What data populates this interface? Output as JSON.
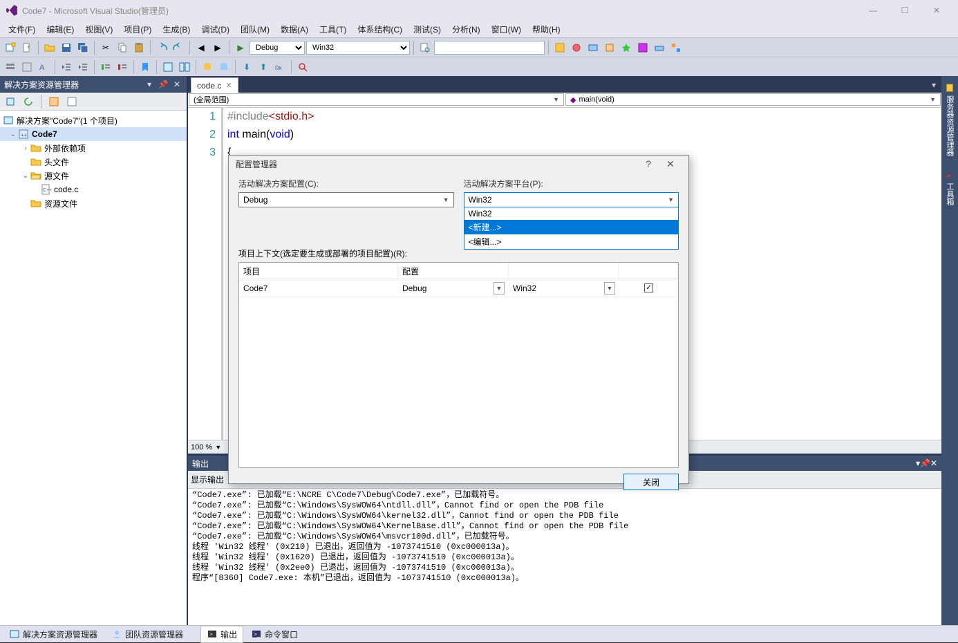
{
  "window": {
    "title": "Code7 - Microsoft Visual Studio(管理员)"
  },
  "menu": [
    "文件(F)",
    "编辑(E)",
    "视图(V)",
    "项目(P)",
    "生成(B)",
    "调试(D)",
    "团队(M)",
    "数据(A)",
    "工具(T)",
    "体系结构(C)",
    "测试(S)",
    "分析(N)",
    "窗口(W)",
    "帮助(H)"
  ],
  "toolbar": {
    "config": "Debug",
    "platform": "Win32",
    "search": ""
  },
  "solution_explorer": {
    "title": "解决方案资源管理器",
    "root": "解决方案\"Code7\"(1 个项目)",
    "project": "Code7",
    "folders": {
      "ext": "外部依赖项",
      "hdr": "头文件",
      "src": "源文件",
      "res": "资源文件"
    },
    "file": "code.c"
  },
  "editor": {
    "tab": "code.c",
    "scope": "(全局范围)",
    "member": "main(void)",
    "lines": [
      {
        "n": "1",
        "html": "<span class='pp'>#include</span><span class='str'>&lt;stdio.h&gt;</span>"
      },
      {
        "n": "2",
        "html": "<span class='kw'>int</span> <span class='fn'>main</span>(<span class='kw'>void</span>)"
      },
      {
        "n": "3",
        "html": "{"
      }
    ],
    "zoom": "100 %"
  },
  "output": {
    "title": "输出",
    "show_label": "显示输出",
    "lines": [
      "“Code7.exe”: 已加载“E:\\NCRE C\\Code7\\Debug\\Code7.exe”，已加载符号。",
      "“Code7.exe”: 已加载“C:\\Windows\\SysWOW64\\ntdll.dll”，Cannot find or open the PDB file",
      "“Code7.exe”: 已加载“C:\\Windows\\SysWOW64\\kernel32.dll”，Cannot find or open the PDB file",
      "“Code7.exe”: 已加载“C:\\Windows\\SysWOW64\\KernelBase.dll”，Cannot find or open the PDB file",
      "“Code7.exe”: 已加载“C:\\Windows\\SysWOW64\\msvcr100d.dll”，已加载符号。",
      "线程 'Win32 线程' (0x210) 已退出，返回值为 -1073741510 (0xc000013a)。",
      "线程 'Win32 线程' (0x1620) 已退出，返回值为 -1073741510 (0xc000013a)。",
      "线程 'Win32 线程' (0x2ee0) 已退出，返回值为 -1073741510 (0xc000013a)。",
      "程序“[8360] Code7.exe: 本机”已退出，返回值为 -1073741510 (0xc000013a)。"
    ]
  },
  "bottom_tabs": [
    "解决方案资源管理器",
    "团队资源管理器",
    "输出",
    "命令窗口"
  ],
  "right_rail": [
    "服务器资源管理器",
    "工具箱"
  ],
  "dialog": {
    "title": "配置管理器",
    "config_label": "活动解决方案配置(C):",
    "platform_label": "活动解决方案平台(P):",
    "config_value": "Debug",
    "platform_value": "Win32",
    "platform_options": [
      "Win32",
      "<新建...>",
      "<编辑...>"
    ],
    "platform_selected_index": 1,
    "context_label": "项目上下文(选定要生成或部署的项目配置)(R):",
    "cols": {
      "project": "项目",
      "config": "配置",
      "platform": "",
      "build": ""
    },
    "row": {
      "project": "Code7",
      "config": "Debug",
      "platform": "Win32",
      "checked": true
    },
    "close": "关闭"
  }
}
